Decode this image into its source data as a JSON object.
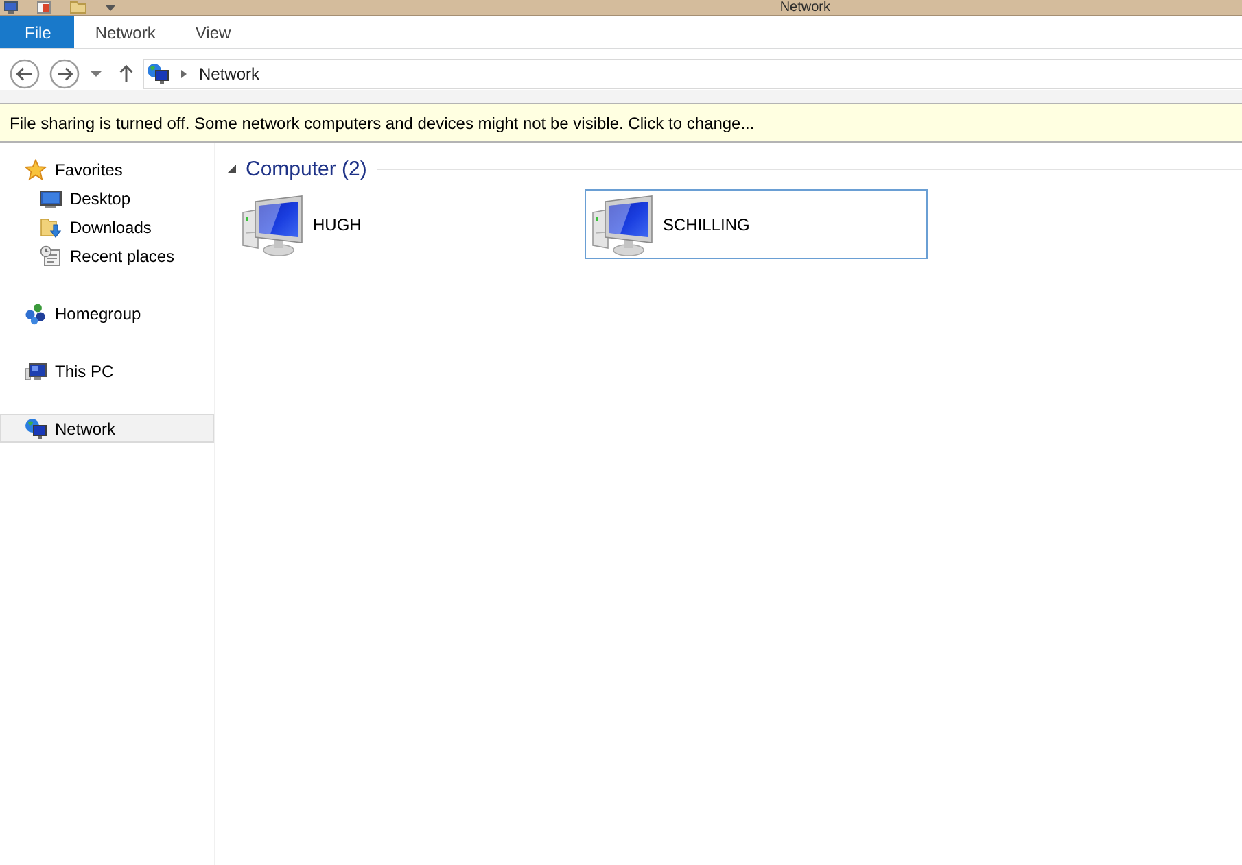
{
  "window": {
    "title": "Network"
  },
  "ribbon": {
    "tabs": [
      {
        "label": "File",
        "kind": "file",
        "selected": false
      },
      {
        "label": "Network",
        "kind": "tab",
        "selected": false
      },
      {
        "label": "View",
        "kind": "tab",
        "selected": false
      }
    ]
  },
  "address_bar": {
    "path": [
      "Network"
    ]
  },
  "info_bar": {
    "text": "File sharing is turned off. Some network computers and devices might not be visible. Click to change..."
  },
  "sidebar": {
    "groups": [
      {
        "label": "Favorites",
        "kind": "favorites",
        "selected": false,
        "children": [
          {
            "label": "Desktop",
            "kind": "desktop",
            "selected": false
          },
          {
            "label": "Downloads",
            "kind": "downloads",
            "selected": false
          },
          {
            "label": "Recent places",
            "kind": "recent",
            "selected": false
          }
        ]
      },
      {
        "label": "Homegroup",
        "kind": "homegroup",
        "selected": false
      },
      {
        "label": "This PC",
        "kind": "pc",
        "selected": false
      },
      {
        "label": "Network",
        "kind": "network",
        "selected": true
      }
    ]
  },
  "content": {
    "groups": [
      {
        "title": "Computer (2)",
        "expanded": true,
        "items": [
          {
            "name": "HUGH",
            "focused": false
          },
          {
            "name": "SCHILLING",
            "focused": true
          }
        ]
      }
    ]
  }
}
